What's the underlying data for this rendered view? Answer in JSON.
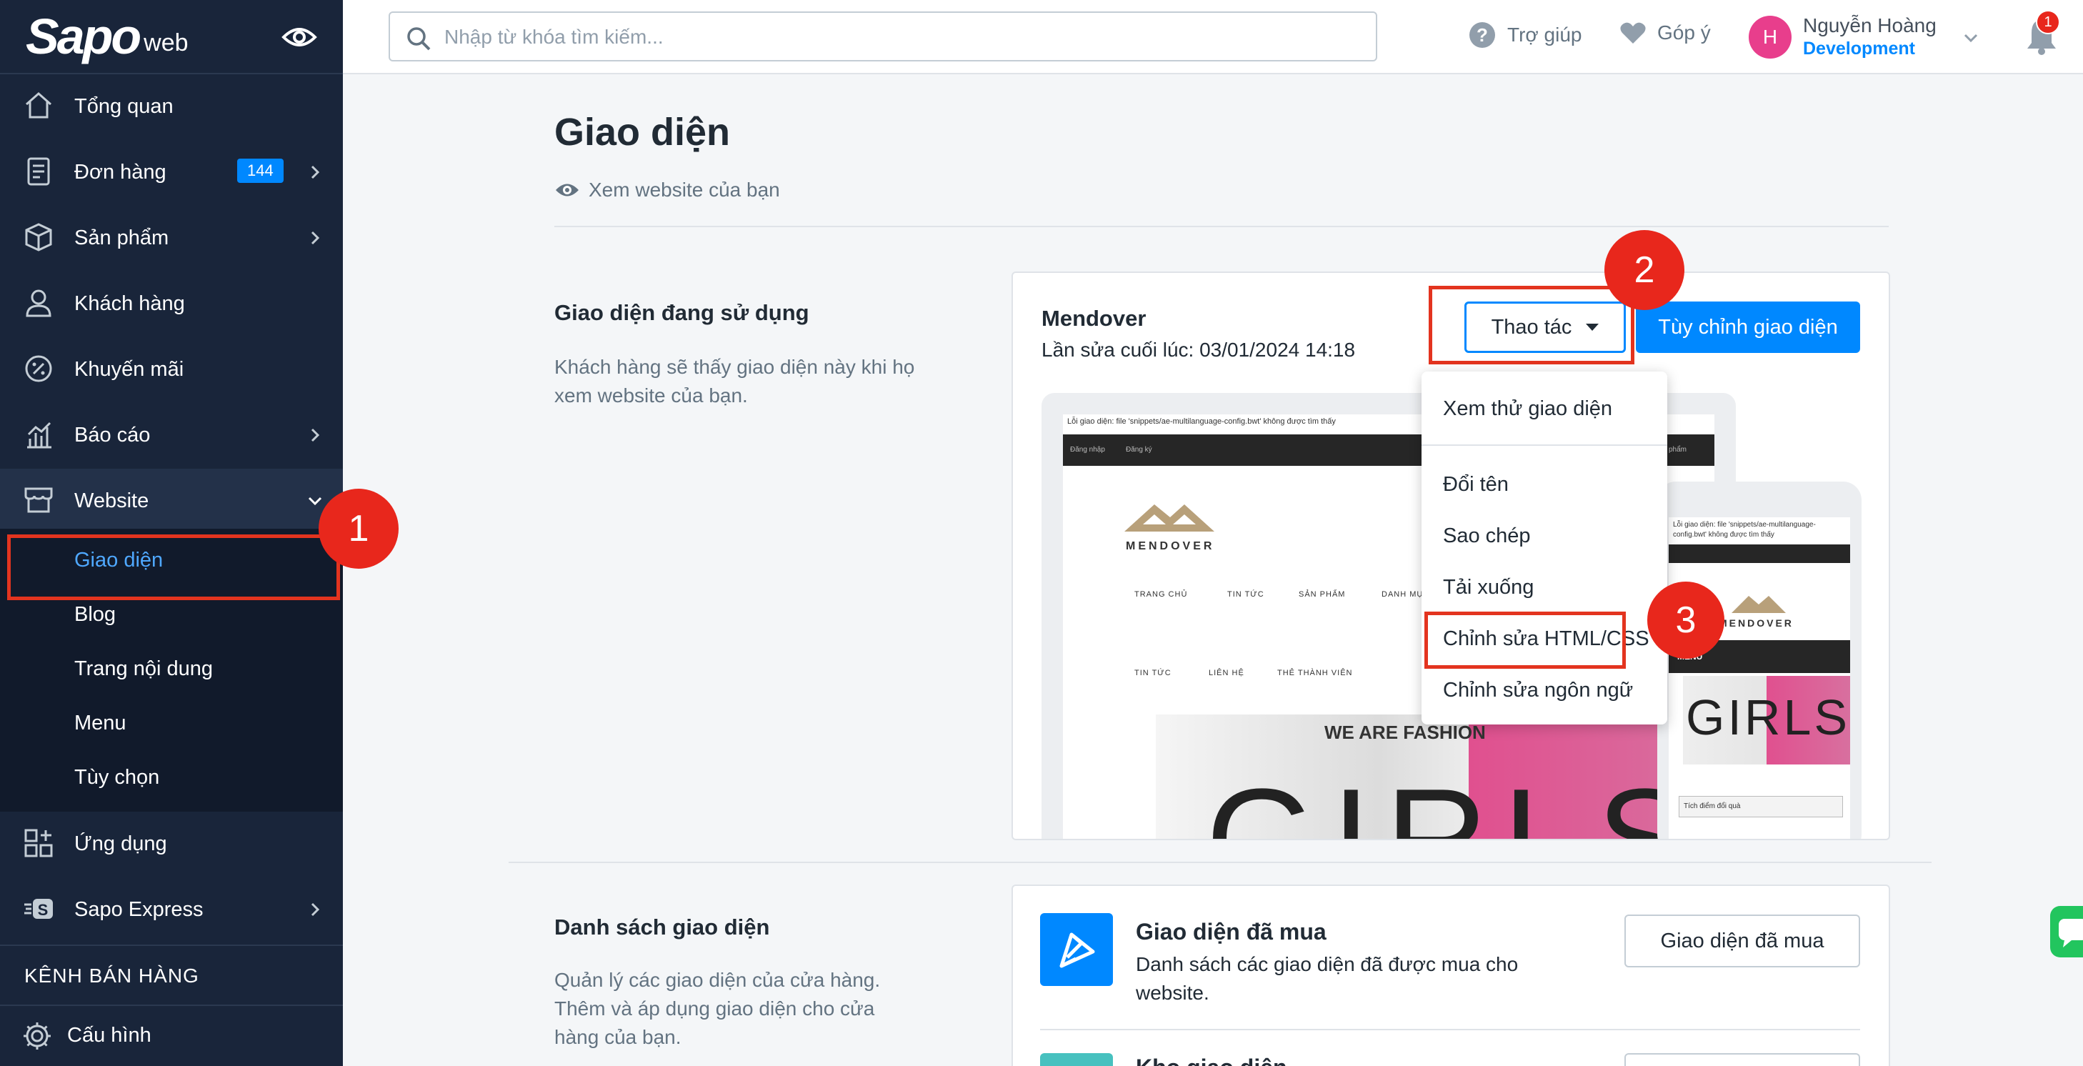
{
  "brand": {
    "main": "Sapo",
    "sub": "web"
  },
  "sidebar": {
    "items": [
      {
        "label": "Tổng quan",
        "icon": "home-icon"
      },
      {
        "label": "Đơn hàng",
        "icon": "order-icon",
        "badge": "144"
      },
      {
        "label": "Sản phẩm",
        "icon": "box-icon"
      },
      {
        "label": "Khách hàng",
        "icon": "user-icon"
      },
      {
        "label": "Khuyến mãi",
        "icon": "discount-icon"
      },
      {
        "label": "Báo cáo",
        "icon": "chart-icon"
      },
      {
        "label": "Website",
        "icon": "store-icon"
      },
      {
        "label": "Ứng dụng",
        "icon": "apps-icon"
      },
      {
        "label": "Sapo Express",
        "icon": "express-icon"
      }
    ],
    "sub_items": [
      "Giao diện",
      "Blog",
      "Trang nội dung",
      "Menu",
      "Tùy chọn"
    ],
    "channel_header": "KÊNH BÁN HÀNG",
    "settings": "Cấu hình"
  },
  "search": {
    "placeholder": "Nhập từ khóa tìm kiếm..."
  },
  "header": {
    "help": "Trợ giúp",
    "feedback": "Góp ý",
    "user_initial": "H",
    "user_name": "Nguyễn Hoàng",
    "user_role": "Development",
    "notifications": "1"
  },
  "page": {
    "title": "Giao diện",
    "view_site": "Xem website của bạn"
  },
  "current_theme": {
    "section_title": "Giao diện đang sử dụng",
    "section_desc": "Khách hàng sẽ thấy giao diện này khi họ xem website của bạn.",
    "name": "Mendover",
    "last_edit": "Lần sửa cuối lúc: 03/01/2024 14:18",
    "actions_label": "Thao tác",
    "customize_label": "Tùy chỉnh giao diện"
  },
  "preview": {
    "error_text": "Lỗi giao diện: file 'snippets/ae-multilanguage-config.bwt' không được tìm thấy",
    "top_links": [
      "Đăng nhập",
      "Đăng ký"
    ],
    "logo_text": "MENDOVER",
    "nav1": [
      "TRANG CHỦ",
      "TIN TỨC",
      "SẢN PHẨM",
      "DANH MỤC"
    ],
    "nav2": [
      "TIN TỨC",
      "LIÊN HỆ",
      "THẺ THÀNH VIÊN"
    ],
    "banner_text": "WE ARE FASHION",
    "banner_big": "GIRLS",
    "mobile_error": "Lỗi giao diện: file 'snippets/ae-multilanguage-config.bwt' không được tìm thấy",
    "mobile_menu": "MENU",
    "mobile_footer": "Tích điểm đổi quà",
    "side_text": "phẩm"
  },
  "dropdown": {
    "items": [
      "Xem thử giao diện",
      "Đổi tên",
      "Sao chép",
      "Tải xuống",
      "Chỉnh sửa HTML/CSS",
      "Chỉnh sửa ngôn ngữ"
    ]
  },
  "theme_list": {
    "section_title": "Danh sách giao diện",
    "section_desc": "Quản lý các giao diện của cửa hàng. Thêm và áp dụng giao diện cho cửa hàng của bạn.",
    "purchased_title": "Giao diện đã mua",
    "purchased_desc": "Danh sách các giao diện đã được mua cho website.",
    "purchased_button": "Giao diện đã mua",
    "next_title": "Kho giao diện"
  },
  "steps": [
    "1",
    "2",
    "3"
  ],
  "colors": {
    "sidebar": "#19253a",
    "accent": "#0088ff",
    "highlight": "#e3341f",
    "marker": "#e8271c"
  }
}
